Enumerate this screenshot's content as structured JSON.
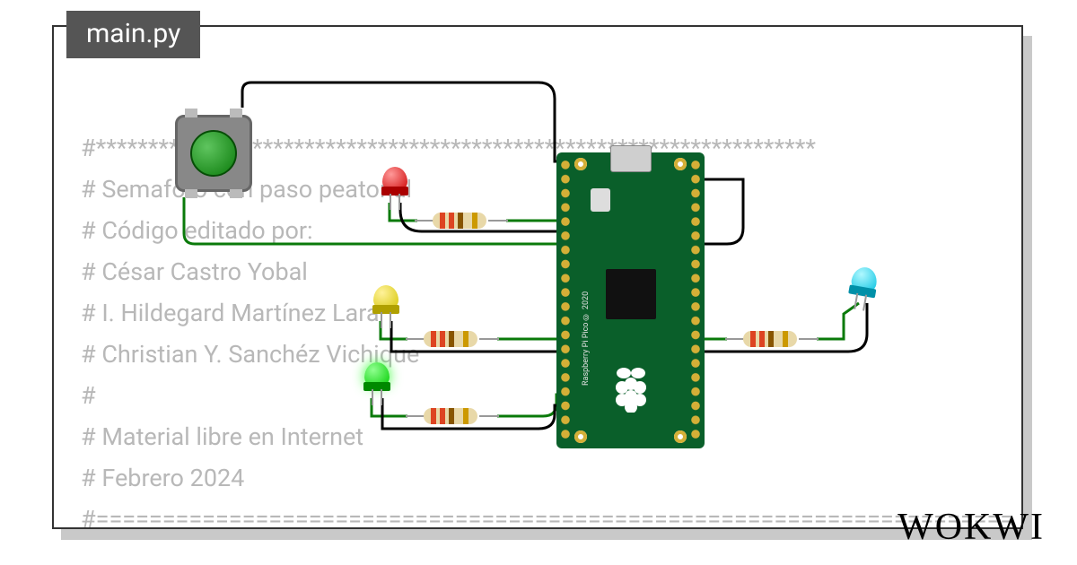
{
  "tab": {
    "filename": "main.py"
  },
  "code": {
    "line1": "#*********************************************************************",
    "line2": "# Semaforo con paso peatonal",
    "line3": "# Código editado por:",
    "line4": "# César Castro Yobal",
    "line5": "# I. Hildegard Martínez Lara",
    "line6": "# Christian Y. Sanchéz Vichique",
    "line7": "#",
    "line8": "# Material libre en Internet",
    "line9": "# Febrero 2024",
    "line10": "#====================================================================="
  },
  "brand": "WOKWI",
  "board": {
    "label": "Raspberry Pi Pico © 2020"
  },
  "components": {
    "button": {
      "color": "green"
    },
    "led_red": {
      "color": "red"
    },
    "led_yellow": {
      "color": "yellow"
    },
    "led_green": {
      "color": "green",
      "state": "on"
    },
    "led_cyan": {
      "color": "cyan"
    },
    "resistor1": "220Ω",
    "resistor2": "220Ω",
    "resistor3": "220Ω",
    "resistor4": "220Ω"
  },
  "wire_color": {
    "signal": "#0a7a0a",
    "ground": "#000000"
  }
}
